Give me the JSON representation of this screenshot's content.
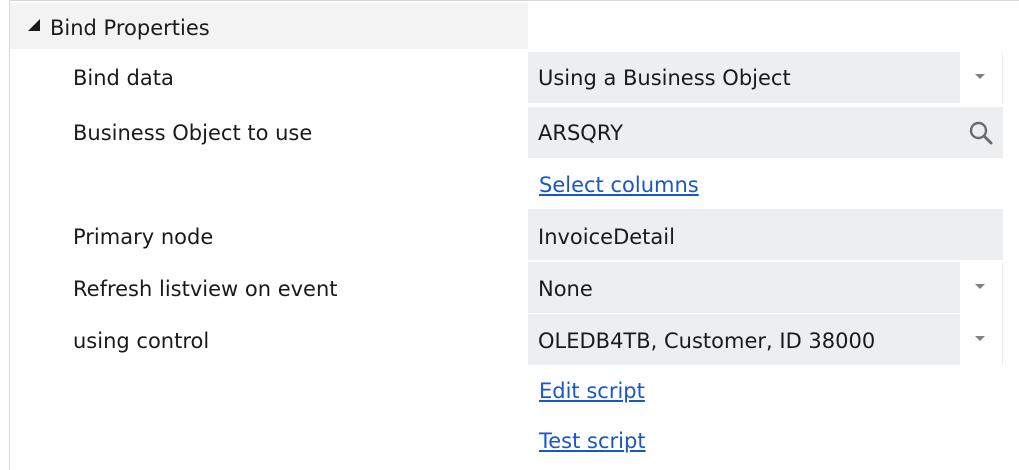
{
  "section": {
    "title": "Bind Properties"
  },
  "rows": {
    "bind_data": {
      "label": "Bind data",
      "value": "Using a Business Object"
    },
    "business_object": {
      "label": "Business Object to use",
      "value": "ARSQRY"
    },
    "select_columns_link": "Select columns",
    "primary_node": {
      "label": "Primary node",
      "value": "InvoiceDetail"
    },
    "refresh_listview": {
      "label": "Refresh listview on event",
      "value": "None"
    },
    "using_control": {
      "label": "using control",
      "value": "OLEDB4TB, Customer, ID 38000"
    },
    "edit_script_link": "Edit script",
    "test_script_link": "Test script"
  },
  "colors": {
    "field_background": "#eceeef",
    "header_background": "#f3f3f3",
    "link": "#1a56c4"
  }
}
